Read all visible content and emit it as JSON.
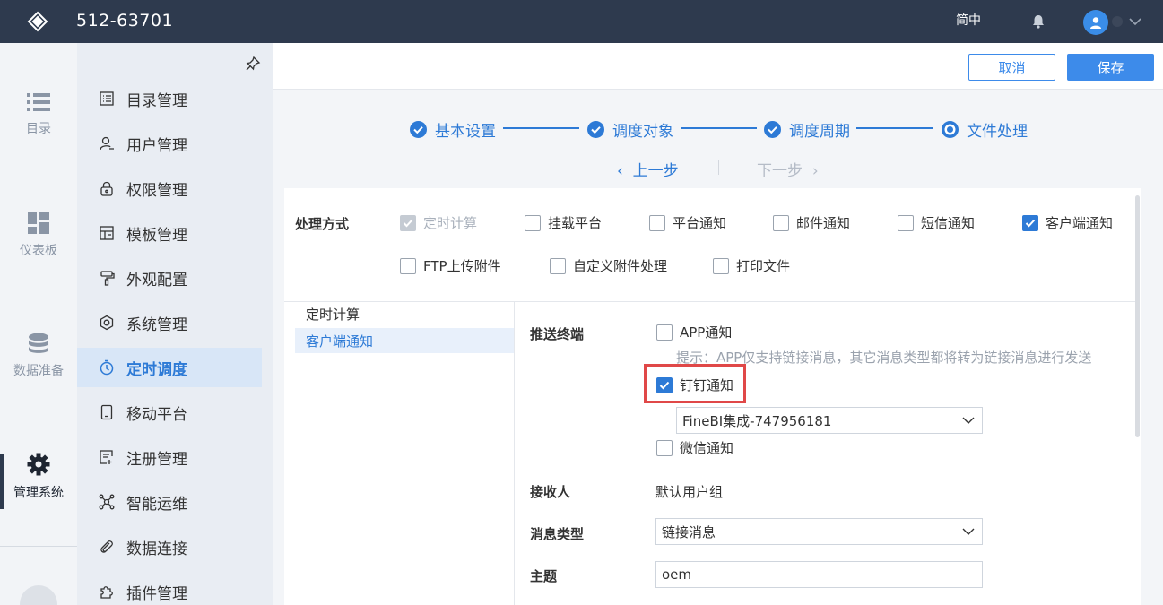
{
  "app": {
    "title": "512-63701",
    "language": "简中",
    "user_name": ""
  },
  "rail": {
    "items": [
      {
        "label": "目录",
        "icon": "list-icon"
      },
      {
        "label": "仪表板",
        "icon": "dashboard-icon"
      },
      {
        "label": "数据准备",
        "icon": "database-icon"
      },
      {
        "label": "管理系统",
        "icon": "gear-icon"
      }
    ]
  },
  "nav": {
    "items": [
      {
        "label": "目录管理",
        "icon": "catalog-icon"
      },
      {
        "label": "用户管理",
        "icon": "user-icon"
      },
      {
        "label": "权限管理",
        "icon": "lock-icon"
      },
      {
        "label": "模板管理",
        "icon": "template-icon"
      },
      {
        "label": "外观配置",
        "icon": "brush-icon"
      },
      {
        "label": "系统管理",
        "icon": "settings-icon"
      },
      {
        "label": "定时调度",
        "icon": "timer-icon"
      },
      {
        "label": "移动平台",
        "icon": "mobile-icon"
      },
      {
        "label": "注册管理",
        "icon": "register-icon"
      },
      {
        "label": "智能运维",
        "icon": "ops-icon"
      },
      {
        "label": "数据连接",
        "icon": "link-icon"
      },
      {
        "label": "插件管理",
        "icon": "plugin-icon"
      }
    ],
    "active": "定时调度"
  },
  "actions": {
    "cancel": "取消",
    "save": "保存"
  },
  "stepper": {
    "steps": [
      "基本设置",
      "调度对象",
      "调度周期",
      "文件处理"
    ],
    "prev": "上一步",
    "next": "下一步"
  },
  "processing": {
    "label": "处理方式",
    "options": [
      {
        "label": "定时计算",
        "checked": true,
        "disabled": true
      },
      {
        "label": "挂载平台",
        "checked": false
      },
      {
        "label": "平台通知",
        "checked": false
      },
      {
        "label": "邮件通知",
        "checked": false
      },
      {
        "label": "短信通知",
        "checked": false
      },
      {
        "label": "客户端通知",
        "checked": true
      },
      {
        "label": "FTP上传附件",
        "checked": false
      },
      {
        "label": "自定义附件处理",
        "checked": false
      },
      {
        "label": "打印文件",
        "checked": false
      }
    ]
  },
  "sublist": {
    "items": [
      "定时计算",
      "客户端通知"
    ],
    "active": "客户端通知"
  },
  "form": {
    "push_label": "推送终端",
    "app_notify": "APP通知",
    "hint": "提示：APP仅支持链接消息，其它消息类型都将转为链接消息进行发送",
    "dingtalk": "钉钉通知",
    "dingtalk_select": "FineBI集成-747956181",
    "wechat": "微信通知",
    "receiver_label": "接收人",
    "receiver_value": "默认用户组",
    "msgtype_label": "消息类型",
    "msgtype_value": "链接消息",
    "subject_label": "主题",
    "subject_value": "oem"
  },
  "colors": {
    "topbar": "#2e3a4e",
    "accent": "#2d7ad6",
    "highlight": "#e04848"
  }
}
